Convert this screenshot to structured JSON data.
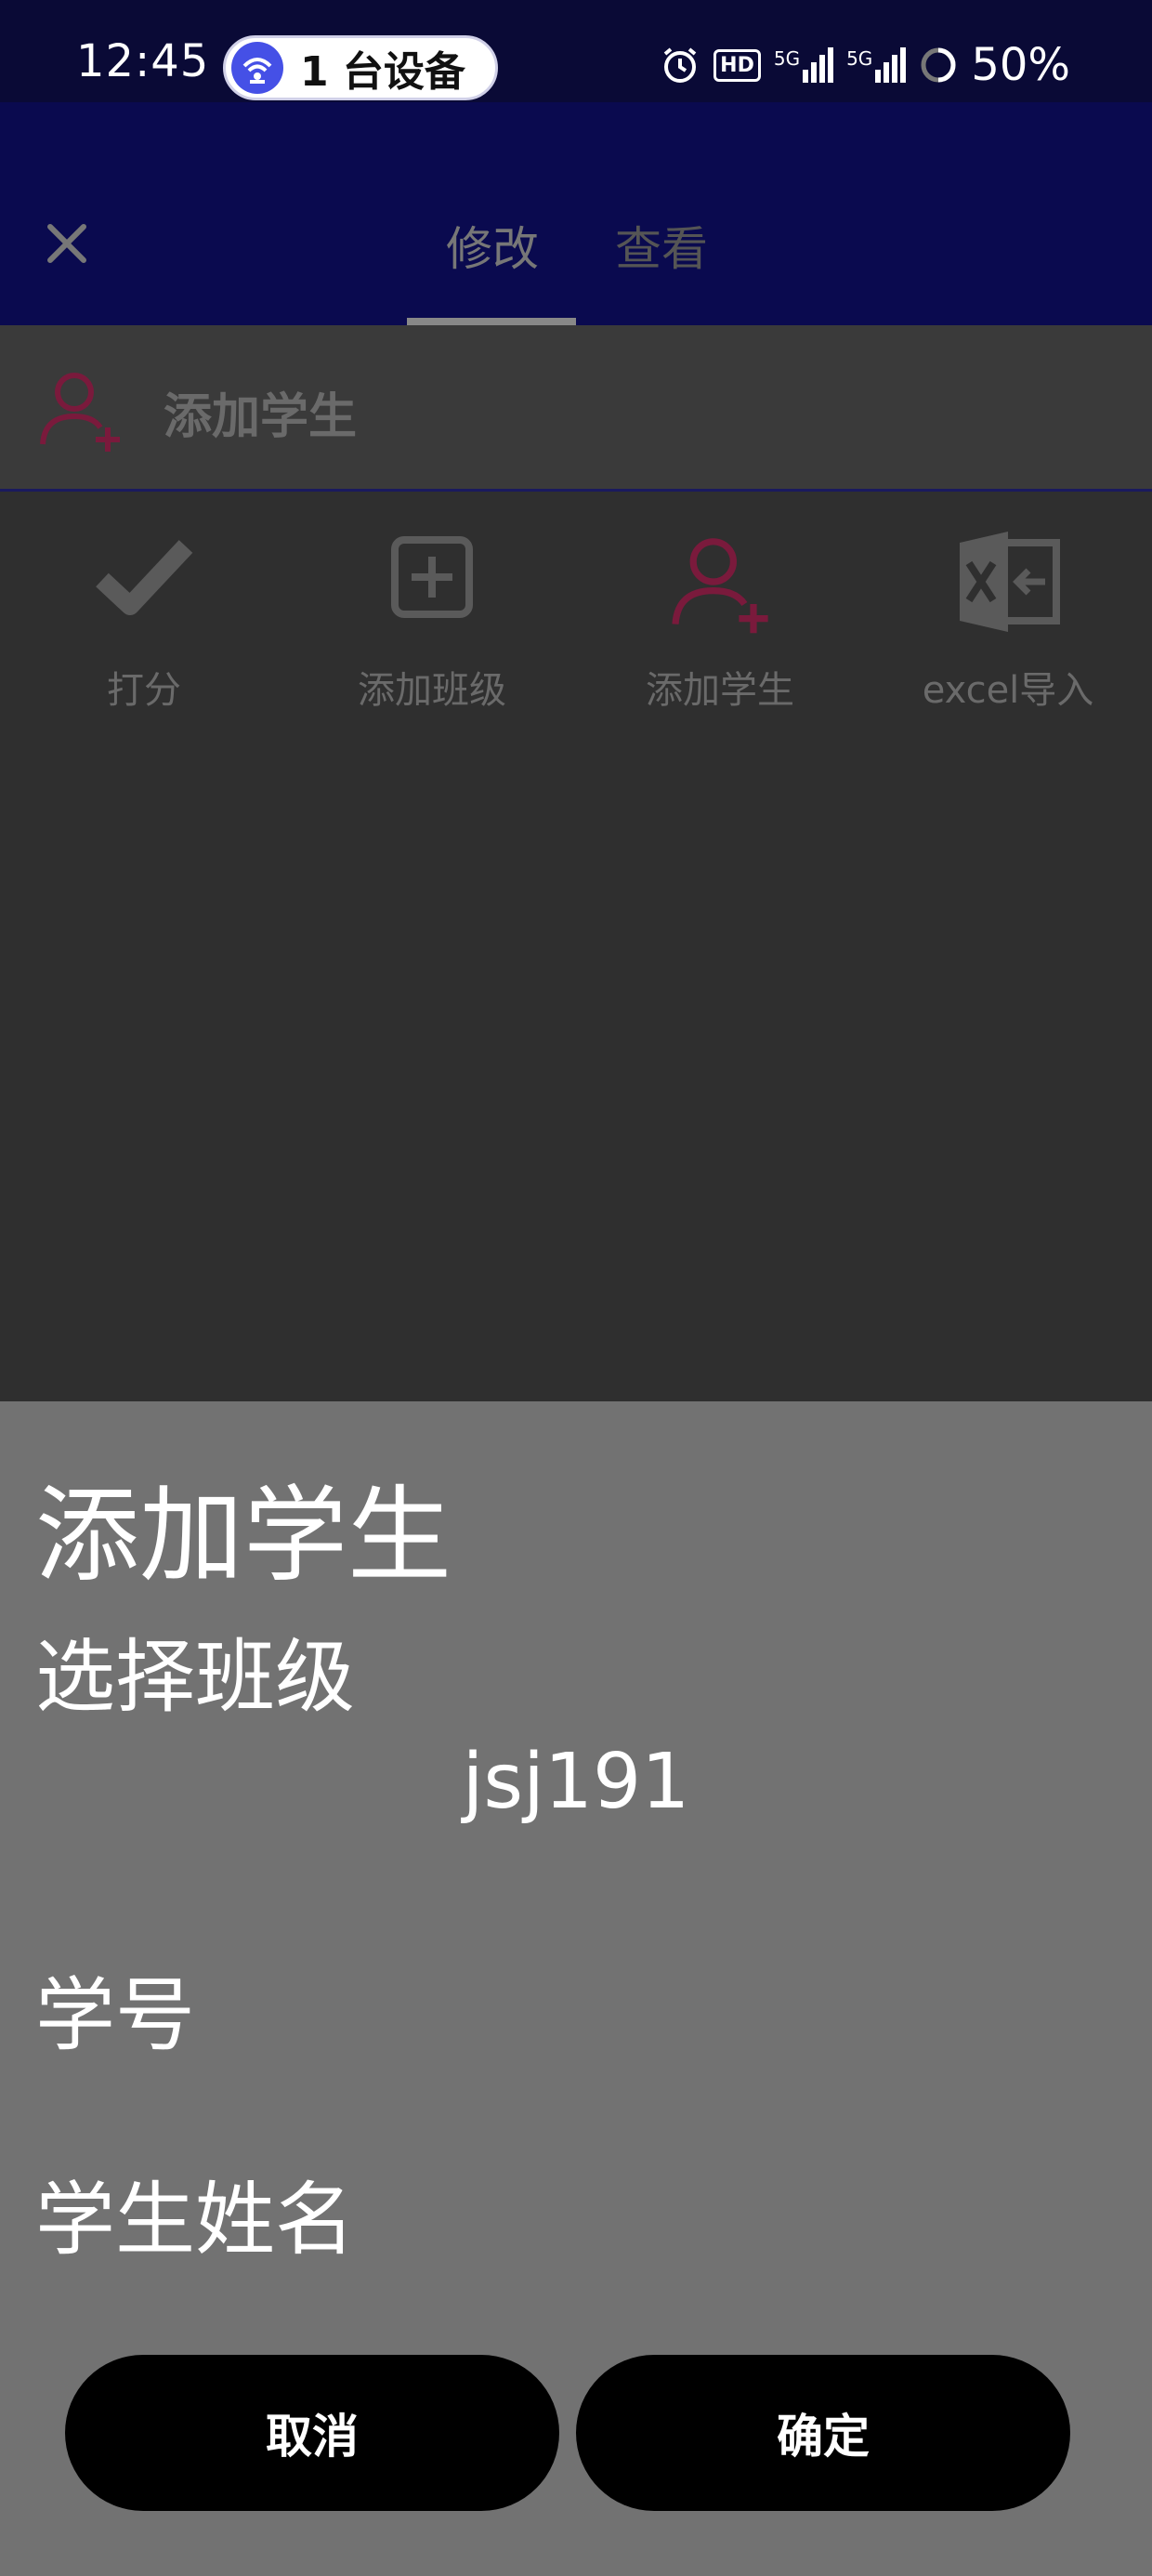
{
  "status_bar": {
    "time": "12:45",
    "devices_pill": "1 台设备",
    "hd_badge": "HD",
    "signal1_label": "5G",
    "signal2_label": "5G",
    "battery": "50%"
  },
  "app_bar": {
    "tabs": [
      {
        "label": "修改",
        "active": true
      },
      {
        "label": "查看",
        "active": false
      }
    ]
  },
  "section_header": {
    "title": "添加学生"
  },
  "grid": {
    "items": [
      {
        "label": "打分",
        "icon": "check-icon"
      },
      {
        "label": "添加班级",
        "icon": "plus-box-icon"
      },
      {
        "label": "添加学生",
        "icon": "add-user-icon"
      },
      {
        "label": "excel导入",
        "icon": "excel-icon"
      }
    ]
  },
  "dialog": {
    "title": "添加学生",
    "class_label": "选择班级",
    "class_selected": "jsj191",
    "student_id_label": "学号",
    "student_id_value": "",
    "student_name_label": "学生姓名",
    "student_name_value": "",
    "cancel_label": "取消",
    "ok_label": "确定"
  },
  "colors": {
    "app_bar": "#0a0a4f",
    "status_bar": "#0a0a36",
    "accent_icon": "#7a1a3c",
    "dialog_bg": "#727272",
    "button_bg": "#000000"
  }
}
